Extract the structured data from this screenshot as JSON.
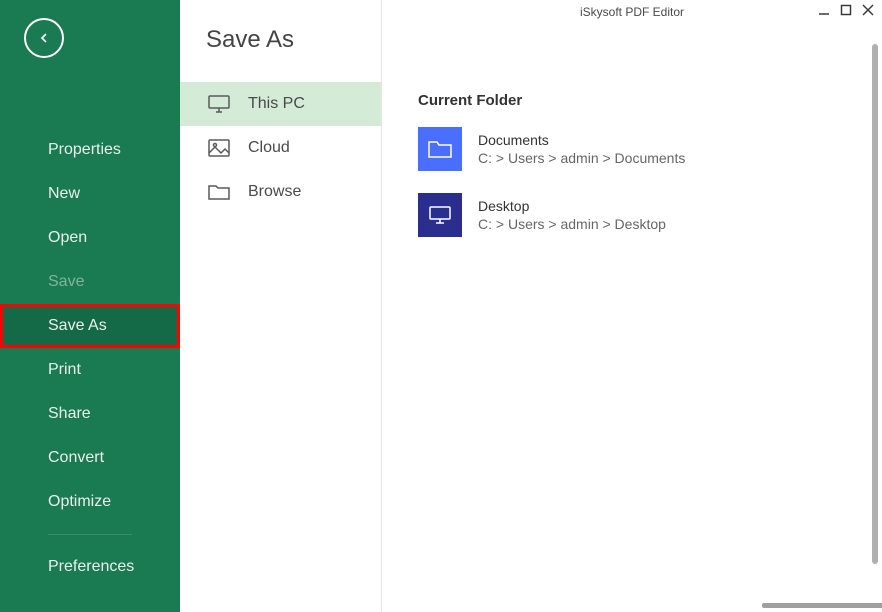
{
  "app": {
    "title": "iSkysoft PDF Editor"
  },
  "sidebar": {
    "items": [
      {
        "label": "Properties"
      },
      {
        "label": "New"
      },
      {
        "label": "Open"
      },
      {
        "label": "Save"
      },
      {
        "label": "Save As"
      },
      {
        "label": "Print"
      },
      {
        "label": "Share"
      },
      {
        "label": "Convert"
      },
      {
        "label": "Optimize"
      },
      {
        "label": "Preferences"
      }
    ]
  },
  "midpanel": {
    "title": "Save As",
    "items": [
      {
        "label": "This PC"
      },
      {
        "label": "Cloud"
      },
      {
        "label": "Browse"
      }
    ]
  },
  "content": {
    "section_title": "Current Folder",
    "folders": [
      {
        "name": "Documents",
        "path": "C: > Users > admin > Documents"
      },
      {
        "name": "Desktop",
        "path": "C: > Users > admin > Desktop"
      }
    ]
  }
}
